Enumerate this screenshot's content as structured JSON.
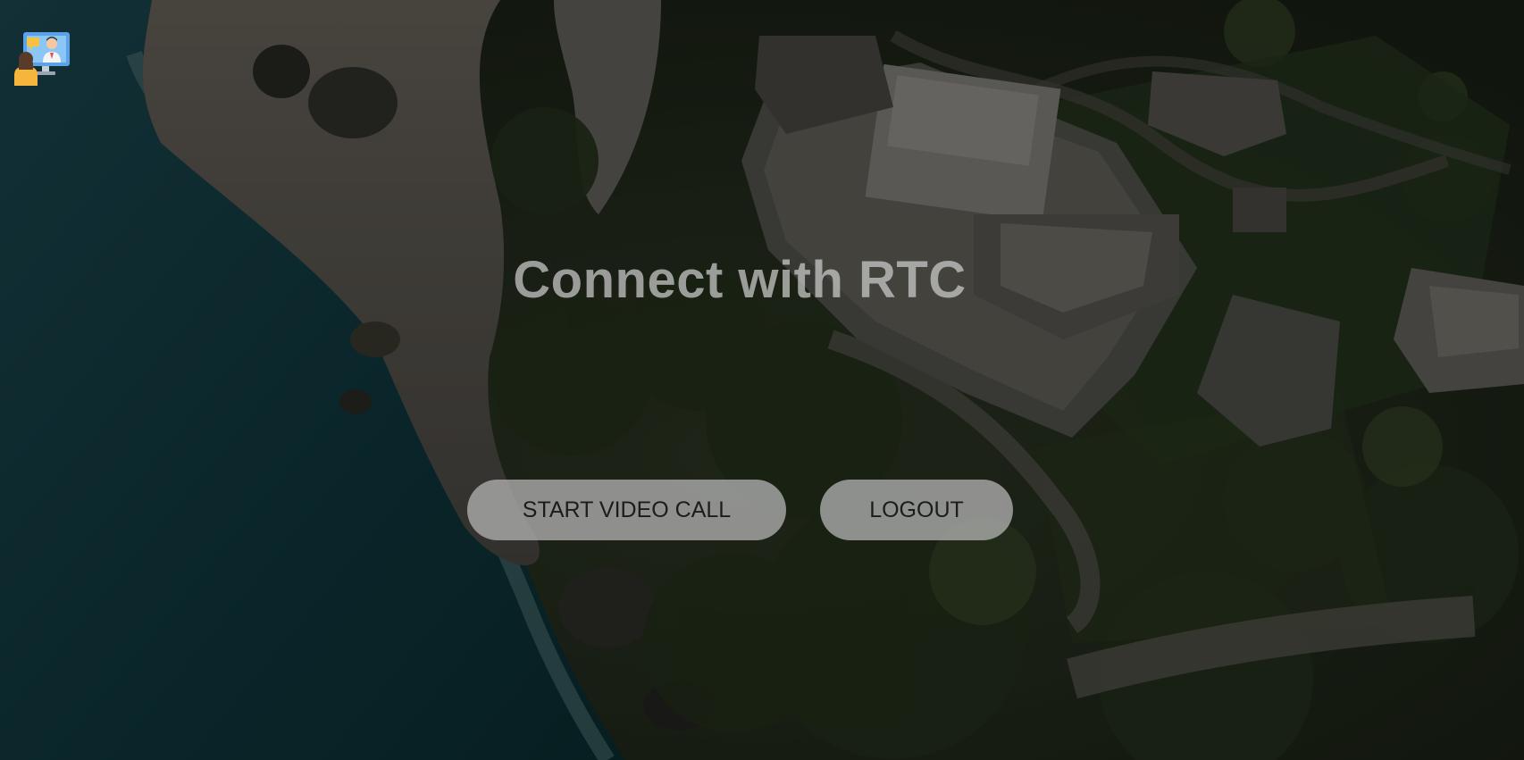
{
  "header": {
    "logo_icon": "video-conference-icon"
  },
  "main": {
    "title": "Connect with RTC",
    "start_video_call_label": "START VIDEO CALL",
    "logout_label": "LOGOUT"
  },
  "background": {
    "icon": "aerial-coast-ruins-image"
  },
  "colors": {
    "button_bg": "#b0b0b0",
    "button_text": "#1c1c1c",
    "title_text": "#cdcdcd"
  }
}
